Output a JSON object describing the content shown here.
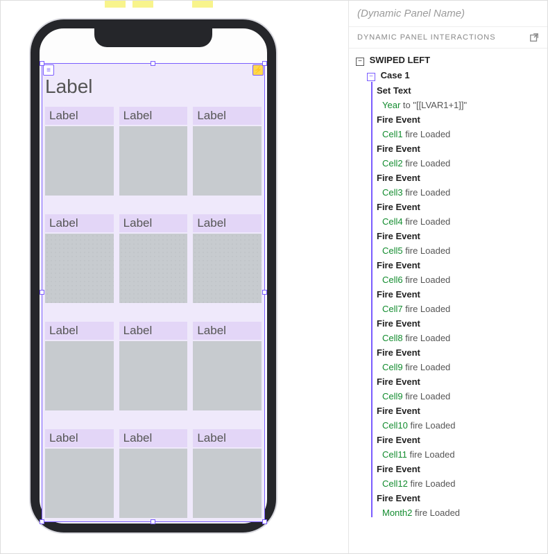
{
  "panelName": "(Dynamic Panel Name)",
  "interactionsHeader": "DYNAMIC PANEL INTERACTIONS",
  "event": {
    "name": "SWIPED LEFT"
  },
  "case": {
    "name": "Case 1"
  },
  "actions": [
    {
      "title": "Set Text",
      "target": "Year",
      "rest": " to \"[[LVAR1+1]]\""
    },
    {
      "title": "Fire Event",
      "target": "Cell1",
      "rest": " fire Loaded"
    },
    {
      "title": "Fire Event",
      "target": "Cell2",
      "rest": " fire Loaded"
    },
    {
      "title": "Fire Event",
      "target": "Cell3",
      "rest": " fire Loaded"
    },
    {
      "title": "Fire Event",
      "target": "Cell4",
      "rest": " fire Loaded"
    },
    {
      "title": "Fire Event",
      "target": "Cell5",
      "rest": " fire Loaded"
    },
    {
      "title": "Fire Event",
      "target": "Cell6",
      "rest": " fire Loaded"
    },
    {
      "title": "Fire Event",
      "target": "Cell7",
      "rest": " fire Loaded"
    },
    {
      "title": "Fire Event",
      "target": "Cell8",
      "rest": " fire Loaded"
    },
    {
      "title": "Fire Event",
      "target": "Cell9",
      "rest": " fire Loaded"
    },
    {
      "title": "Fire Event",
      "target": "Cell9",
      "rest": " fire Loaded"
    },
    {
      "title": "Fire Event",
      "target": "Cell10",
      "rest": " fire Loaded"
    },
    {
      "title": "Fire Event",
      "target": "Cell11",
      "rest": " fire Loaded"
    },
    {
      "title": "Fire Event",
      "target": "Cell12",
      "rest": " fire Loaded"
    },
    {
      "title": "Fire Event",
      "target": "Month2",
      "rest": " fire Loaded"
    }
  ],
  "bigLabel": "Label",
  "cellLabel": "Label",
  "icons": {
    "layers": "≡",
    "bolt": "⚡",
    "minus": "−",
    "popout": "↗"
  }
}
